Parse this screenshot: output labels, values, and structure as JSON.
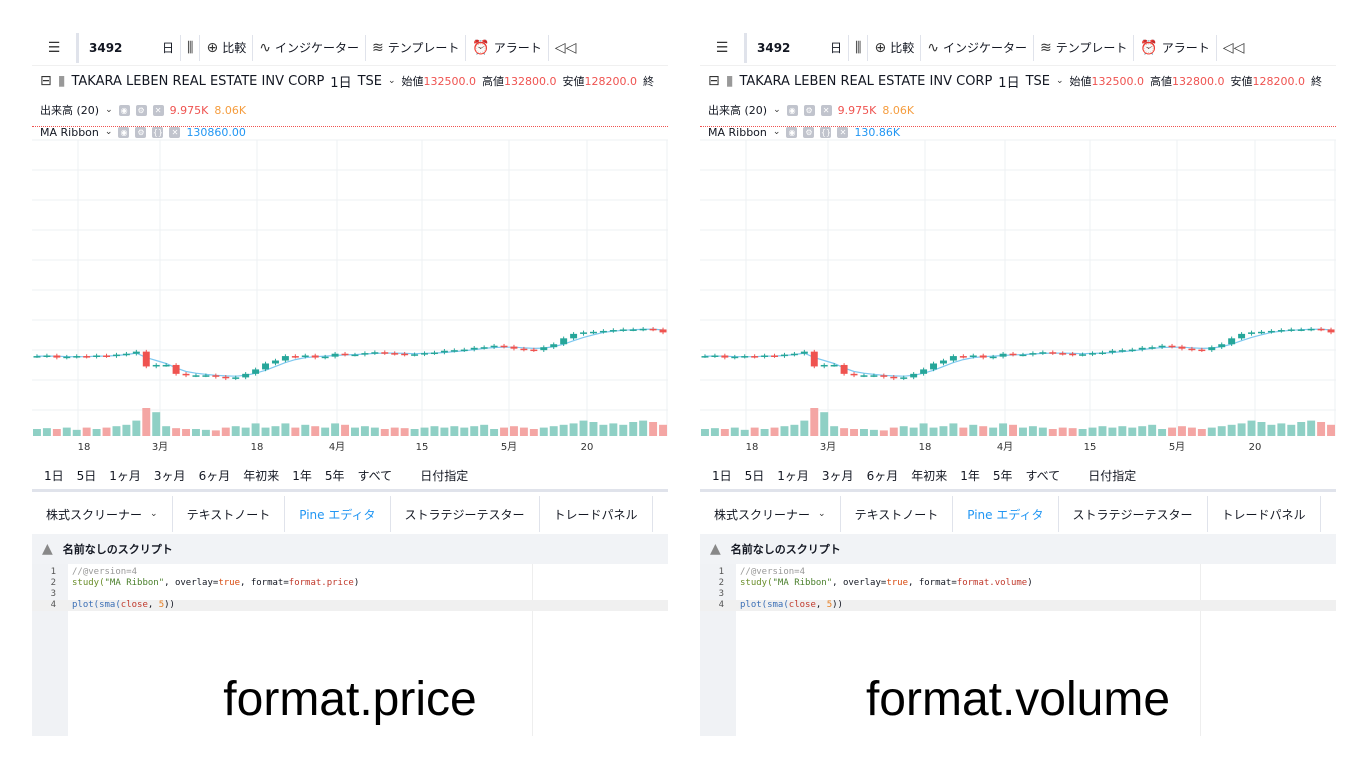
{
  "toolbar": {
    "symbol": "3492",
    "interval": "日",
    "compare": "比較",
    "indicators": "インジケーター",
    "templates": "テンプレート",
    "alert": "アラート"
  },
  "legend": {
    "name": "TAKARA LEBEN REAL ESTATE INV CORP",
    "interval": "1日",
    "exchange": "TSE",
    "open_label": "始値",
    "open": "132500.0",
    "high_label": "高値",
    "high": "132800.0",
    "low_label": "安値",
    "low": "128200.0",
    "close_label_fragment": "終"
  },
  "volume": {
    "label": "出来高 (20)",
    "value": "9.975K",
    "ma": "8.06K"
  },
  "ma_ribbon": {
    "label": "MA Ribbon",
    "value_price": "130860.00",
    "value_volume": "130.86K"
  },
  "x_axis": [
    "18",
    "3月",
    "18",
    "4月",
    "15",
    "5月",
    "20"
  ],
  "ranges": [
    "1日",
    "5日",
    "1ヶ月",
    "3ヶ月",
    "6ヶ月",
    "年初来",
    "1年",
    "5年",
    "すべて",
    "日付指定"
  ],
  "tabs": [
    "株式スクリーナー",
    "テキストノート",
    "Pine エディタ",
    "ストラテジーテスター",
    "トレードパネル"
  ],
  "editor": {
    "title": "名前なしのスクリプト",
    "line_numbers": [
      "1",
      "2",
      "3",
      "4"
    ],
    "line1": "//@version=4",
    "study_fn": "study(",
    "study_name": "\"MA Ribbon\"",
    "overlay_arg": ", overlay=",
    "overlay_val": "true",
    "format_arg": ", format=",
    "format_price": "format.price",
    "format_volume": "format.volume",
    "close_paren": ")",
    "plot_fn": "plot(",
    "sma_fn": "sma(",
    "close_arg": "close",
    "comma": ", ",
    "length": "5",
    "plot_close": "))"
  },
  "captions": {
    "left": "format.price",
    "right": "format.volume"
  },
  "colors": {
    "up": "#26a69a",
    "down": "#ef5350",
    "vol_up": "#8fd0c5",
    "vol_down": "#f4a6a4",
    "ma": "#7ec8f0",
    "accent": "#2196f3"
  },
  "chart_data": {
    "type": "candlestick",
    "ylim": [
      0,
      1
    ],
    "close": [
      0.27,
      0.272,
      0.265,
      0.268,
      0.27,
      0.268,
      0.272,
      0.27,
      0.275,
      0.278,
      0.285,
      0.235,
      0.24,
      0.24,
      0.21,
      0.205,
      0.205,
      0.205,
      0.2,
      0.195,
      0.198,
      0.21,
      0.225,
      0.245,
      0.255,
      0.27,
      0.268,
      0.272,
      0.265,
      0.268,
      0.278,
      0.275,
      0.275,
      0.28,
      0.283,
      0.28,
      0.278,
      0.275,
      0.276,
      0.28,
      0.282,
      0.288,
      0.29,
      0.292,
      0.298,
      0.3,
      0.305,
      0.302,
      0.295,
      0.292,
      0.29,
      0.3,
      0.31,
      0.33,
      0.345,
      0.35,
      0.352,
      0.355,
      0.358,
      0.36,
      0.36,
      0.362,
      0.36,
      0.35
    ],
    "volume": [
      0.25,
      0.28,
      0.25,
      0.3,
      0.22,
      0.3,
      0.25,
      0.3,
      0.35,
      0.4,
      0.55,
      1.0,
      0.85,
      0.35,
      0.28,
      0.25,
      0.25,
      0.22,
      0.2,
      0.3,
      0.35,
      0.3,
      0.45,
      0.3,
      0.35,
      0.45,
      0.3,
      0.4,
      0.35,
      0.3,
      0.45,
      0.4,
      0.3,
      0.35,
      0.3,
      0.25,
      0.3,
      0.28,
      0.25,
      0.3,
      0.35,
      0.3,
      0.35,
      0.3,
      0.35,
      0.4,
      0.25,
      0.3,
      0.35,
      0.3,
      0.25,
      0.3,
      0.35,
      0.4,
      0.45,
      0.55,
      0.5,
      0.4,
      0.45,
      0.4,
      0.5,
      0.55,
      0.5,
      0.4
    ],
    "ma": [
      0.27,
      0.27,
      0.27,
      0.268,
      0.268,
      0.268,
      0.27,
      0.27,
      0.272,
      0.275,
      0.28,
      0.265,
      0.255,
      0.245,
      0.23,
      0.218,
      0.212,
      0.208,
      0.205,
      0.203,
      0.202,
      0.205,
      0.212,
      0.222,
      0.235,
      0.248,
      0.258,
      0.265,
      0.268,
      0.27,
      0.272,
      0.274,
      0.275,
      0.277,
      0.279,
      0.28,
      0.28,
      0.279,
      0.278,
      0.279,
      0.28,
      0.282,
      0.285,
      0.288,
      0.292,
      0.296,
      0.299,
      0.3,
      0.3,
      0.298,
      0.296,
      0.297,
      0.302,
      0.31,
      0.322,
      0.333,
      0.342,
      0.35,
      0.354,
      0.357,
      0.359,
      0.36,
      0.361,
      0.358
    ]
  }
}
